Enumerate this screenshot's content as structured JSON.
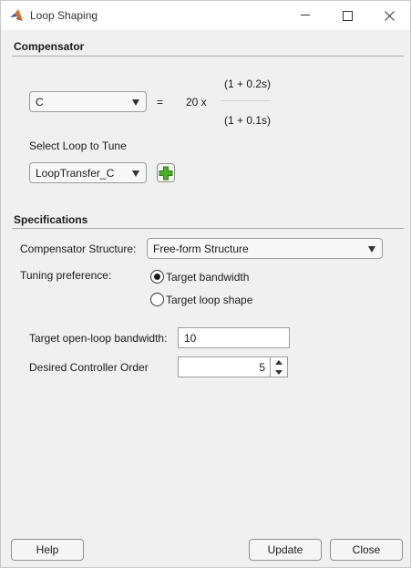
{
  "window": {
    "title": "Loop Shaping"
  },
  "compensator": {
    "heading": "Compensator",
    "block_select": "C",
    "equals": "=",
    "gain": "20 x",
    "numerator": "(1 + 0.2s)",
    "denominator": "(1 + 0.1s)",
    "loop_label": "Select Loop to Tune",
    "loop_select": "LoopTransfer_C"
  },
  "specifications": {
    "heading": "Specifications",
    "structure_label": "Compensator Structure:",
    "structure_select": "Free-form Structure",
    "preference_label": "Tuning preference:",
    "options": [
      {
        "label": "Target bandwidth",
        "checked": true
      },
      {
        "label": "Target loop shape",
        "checked": false
      }
    ],
    "bandwidth_label": "Target open-loop bandwidth:",
    "bandwidth_value": "10",
    "order_label": "Desired Controller Order",
    "order_value": "5"
  },
  "buttons": {
    "help": "Help",
    "update": "Update",
    "close": "Close"
  },
  "colors": {
    "accent_plus": "#4caf28",
    "logo_orange": "#e2681b",
    "logo_blue": "#1f5f9e"
  }
}
